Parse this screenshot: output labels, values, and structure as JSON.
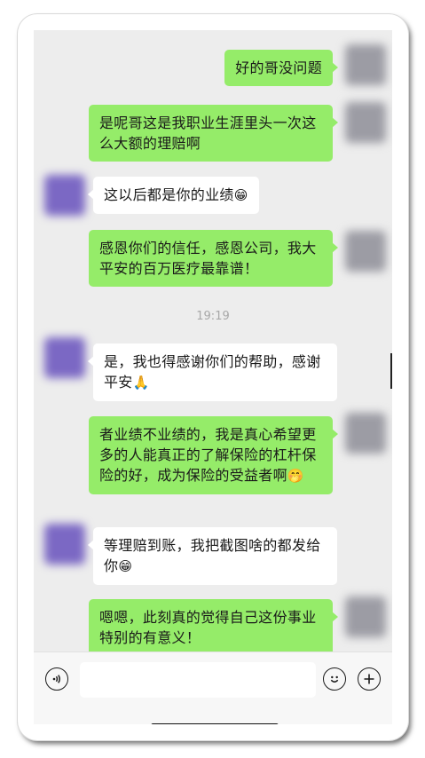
{
  "messages": [
    {
      "side": "mine",
      "text": "好的哥没问题"
    },
    {
      "side": "mine",
      "text": "是呢哥这是我职业生涯里头一次这么大额的理赔啊"
    },
    {
      "side": "theirs",
      "text": "这以后都是你的业绩",
      "emoji": "😁"
    },
    {
      "side": "mine",
      "text": "感恩你们的信任，感恩公司，我大平安的百万医疗最靠谱！"
    },
    {
      "side": "theirs",
      "text": "是，我也得感谢你们的帮助，感谢平安",
      "emoji": "🙏"
    },
    {
      "side": "mine",
      "text": "者业绩不业绩的，我是真心希望更多的人能真正的了解保险的杠杆保险的好，成为保险的受益者啊",
      "emoji": "🤭"
    },
    {
      "side": "theirs",
      "text": "等理赔到账，我把截图啥的都发给你",
      "emoji": "😁"
    },
    {
      "side": "mine",
      "text": "嗯嗯，此刻真的觉得自己这份事业特别的有意义！"
    }
  ],
  "timestamp": "19:19",
  "input_bar": {
    "voice_icon": "voice-icon",
    "emoji_icon": "emoji-icon",
    "plus_icon": "plus-icon",
    "input_value": ""
  }
}
